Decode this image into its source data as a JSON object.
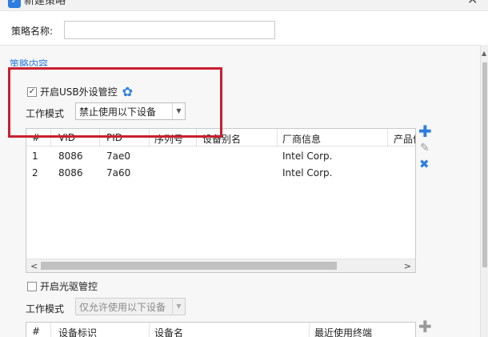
{
  "window": {
    "title": "新建策略",
    "close_glyph": "✕"
  },
  "name_field": {
    "label": "策略名称:",
    "value": ""
  },
  "section_title": "策略内容",
  "usb": {
    "checkbox_label": "开启USB外设管控",
    "checked": true,
    "mode_label": "工作模式",
    "mode_value": "禁止使用以下设备",
    "columns": [
      "#",
      "VID",
      "PID",
      "序列号",
      "设备别名",
      "厂商信息",
      "产品信"
    ],
    "rows": [
      {
        "idx": "1",
        "vid": "8086",
        "pid": "7ae0",
        "serial": "",
        "alias": "",
        "vendor": "Intel Corp.",
        "product": ""
      },
      {
        "idx": "2",
        "vid": "8086",
        "pid": "7a60",
        "serial": "",
        "alias": "",
        "vendor": "Intel Corp.",
        "product": ""
      }
    ],
    "tools": [
      "plus-icon",
      "pencil-icon",
      "x-icon"
    ]
  },
  "optical": {
    "checkbox_label": "开启光驱管控",
    "checked": false,
    "mode_label": "工作模式",
    "mode_value": "仅允许使用以下设备",
    "columns": [
      "#",
      "设备标识",
      "设备名",
      "最近使用终端"
    ]
  },
  "colors": {
    "accent": "#2e7de1",
    "highlight": "#c8202f"
  }
}
